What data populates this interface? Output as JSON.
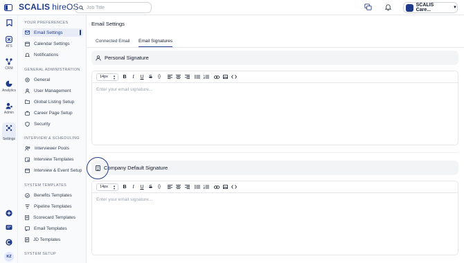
{
  "topbar": {
    "logo_brand": "SCALIS",
    "logo_product": "hireOS",
    "search_placeholder": "Job Title",
    "account_name": "SCALIS Care..."
  },
  "rail": {
    "items": [
      {
        "label": "",
        "icon": "bookmark-icon"
      },
      {
        "label": "ATS",
        "icon": "ats-icon"
      },
      {
        "label": "CRM",
        "icon": "crm-icon"
      },
      {
        "label": "Analytics",
        "icon": "analytics-icon"
      },
      {
        "label": "Admin",
        "icon": "admin-icon"
      },
      {
        "label": "Settings",
        "icon": "settings-icon"
      }
    ],
    "avatar_initials": "KZ"
  },
  "sidebar": {
    "sections": [
      {
        "title": "YOUR PREFERENCES",
        "items": [
          "Email Settings",
          "Calendar Settings",
          "Notifications"
        ]
      },
      {
        "title": "GENERAL ADMINISTRATION",
        "items": [
          "General",
          "User Management",
          "Global Listing Setup",
          "Career Page Setup",
          "Security"
        ]
      },
      {
        "title": "INTERVIEW & SCHEDULING",
        "items": [
          "Interviewer Pools",
          "Interview Templates",
          "Interview & Event Setup"
        ]
      },
      {
        "title": "SYSTEM TEMPLATES",
        "items": [
          "Benefits Templates",
          "Pipeline Templates",
          "Scorecard Templates",
          "Email Templates",
          "JD Templates"
        ]
      },
      {
        "title": "SYSTEM SETUP",
        "items": []
      }
    ],
    "active_item": "Email Settings"
  },
  "main": {
    "title": "Email Settings",
    "tabs": [
      "Connected Email",
      "Email Signatures"
    ],
    "active_tab": "Email Signatures",
    "personal_signature": {
      "title": "Personal Signature",
      "font_size": "14px",
      "placeholder": "Enter your email signature..."
    },
    "company_signature": {
      "title": "Company Default Signature",
      "font_size": "14px",
      "placeholder": "Enter your email signature..."
    }
  },
  "colors": {
    "brand": "#1e3a8a",
    "sidebar_bg": "#f8fafc",
    "active_bg": "#e8ecf6"
  }
}
